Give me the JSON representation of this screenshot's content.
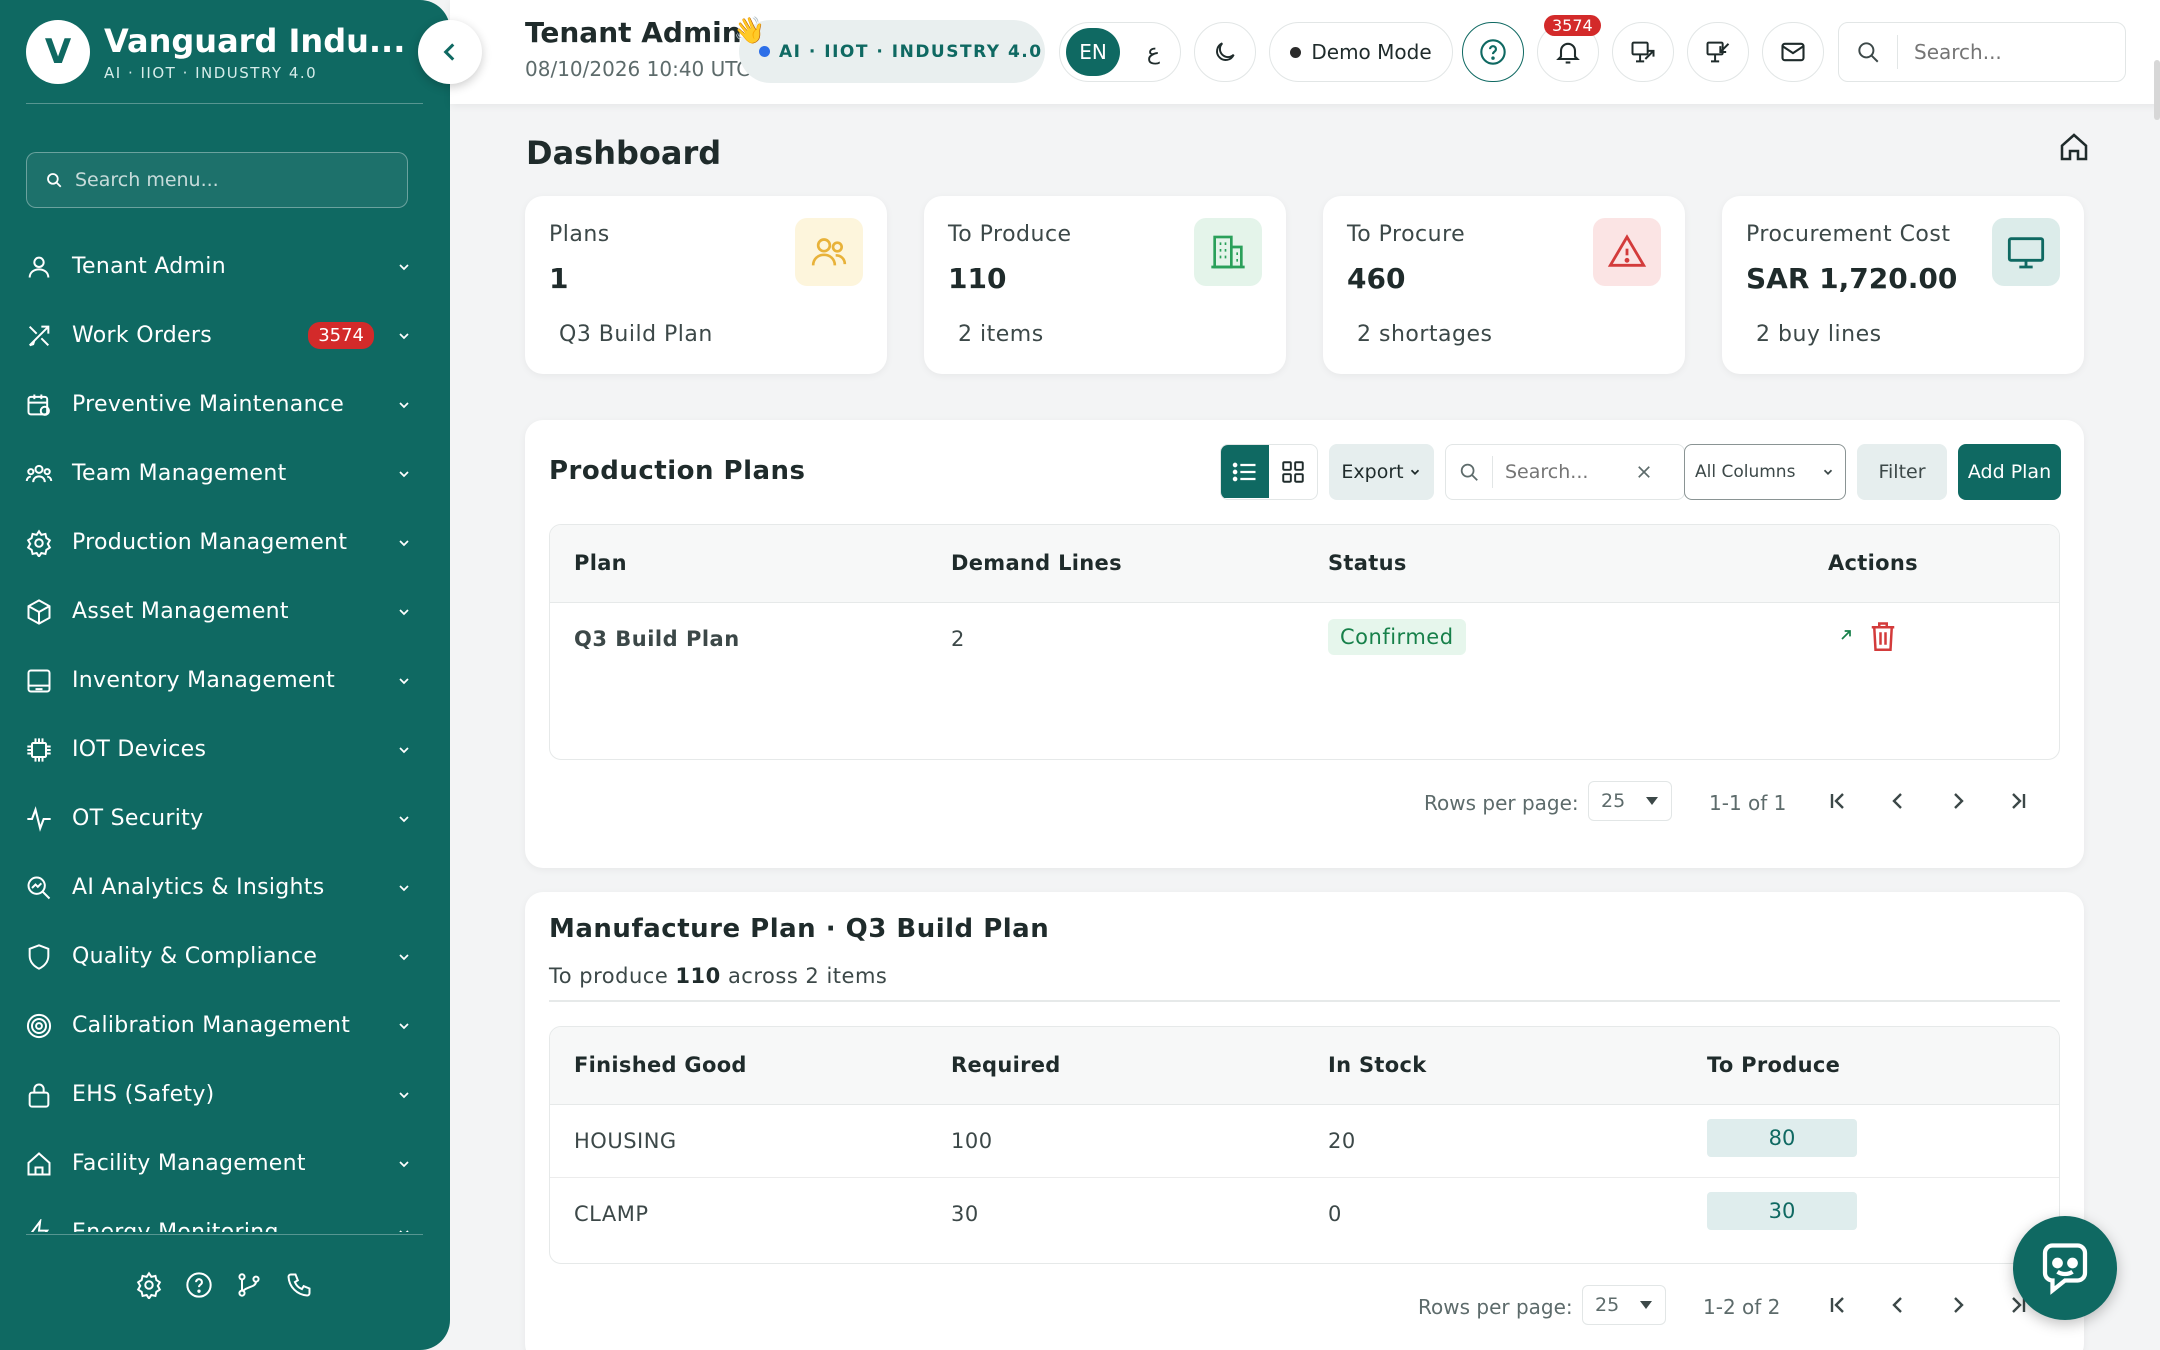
{
  "brand": {
    "initial": "V",
    "name": "Vanguard Indu...",
    "tagline": "AI · IIOT · INDUSTRY 4.0"
  },
  "sidebar": {
    "search_placeholder": "Search menu...",
    "items": [
      {
        "label": "Tenant Admin",
        "icon": "user-icon"
      },
      {
        "label": "Work Orders",
        "icon": "tools-icon",
        "badge": "3574"
      },
      {
        "label": "Preventive Maintenance",
        "icon": "calendar-gear-icon"
      },
      {
        "label": "Team Management",
        "icon": "team-icon"
      },
      {
        "label": "Production Management",
        "icon": "gear-icon"
      },
      {
        "label": "Asset Management",
        "icon": "box-icon"
      },
      {
        "label": "Inventory Management",
        "icon": "inventory-icon"
      },
      {
        "label": "IOT Devices",
        "icon": "chip-icon"
      },
      {
        "label": "OT Security",
        "icon": "pulse-icon"
      },
      {
        "label": "AI Analytics & Insights",
        "icon": "analytics-icon"
      },
      {
        "label": "Quality & Compliance",
        "icon": "shield-icon"
      },
      {
        "label": "Calibration Management",
        "icon": "target-icon"
      },
      {
        "label": "EHS (Safety)",
        "icon": "lock-icon"
      },
      {
        "label": "Facility Management",
        "icon": "home-icon"
      },
      {
        "label": "Energy Monitoring",
        "icon": "bolt-icon"
      }
    ]
  },
  "header": {
    "user_name": "Tenant Admin",
    "datetime": "08/10/2026 10:40 UTC",
    "ai_tag": "AI · IIOT · INDUSTRY 4.0",
    "lang_en": "EN",
    "lang_ar": "ع",
    "demo_mode": "Demo Mode",
    "notifications": "3574",
    "search_placeholder": "Search..."
  },
  "page": {
    "title": "Dashboard"
  },
  "stats": [
    {
      "label": "Plans",
      "value": "1",
      "sub": "Q3 Build Plan",
      "icon": "people-icon",
      "bg": "#fdf5dc",
      "fg": "#e8b23a"
    },
    {
      "label": "To Produce",
      "value": "110",
      "sub": "2 items",
      "icon": "building-icon",
      "bg": "#e4f4ea",
      "fg": "#2aa05a"
    },
    {
      "label": "To Procure",
      "value": "460",
      "sub": "2 shortages",
      "icon": "alert-icon",
      "bg": "#fbe4e4",
      "fg": "#d33b3b"
    },
    {
      "label": "Procurement Cost",
      "value": "SAR 1,720.00",
      "sub": "2 buy lines",
      "icon": "monitor-icon",
      "bg": "#dcecea",
      "fg": "#0f6962"
    }
  ],
  "plans_card": {
    "title": "Production Plans",
    "export": "Export",
    "search_placeholder": "Search...",
    "columns_select": "All Columns",
    "filter": "Filter",
    "add": "Add Plan",
    "headers": [
      "Plan",
      "Demand Lines",
      "Status",
      "Actions"
    ],
    "rows": [
      {
        "plan": "Q3 Build Plan",
        "demand_lines": "2",
        "status": "Confirmed"
      }
    ],
    "rows_per_page_label": "Rows per page:",
    "rows_per_page": "25",
    "range": "1-1 of 1"
  },
  "manufacture_card": {
    "title": "Manufacture Plan · Q3 Build Plan",
    "sub_prefix": "To produce ",
    "sub_value": "110",
    "sub_suffix": " across 2 items",
    "headers": [
      "Finished Good",
      "Required",
      "In Stock",
      "To Produce"
    ],
    "rows": [
      {
        "good": "HOUSING",
        "required": "100",
        "in_stock": "20",
        "to_produce": "80"
      },
      {
        "good": "CLAMP",
        "required": "30",
        "in_stock": "0",
        "to_produce": "30"
      }
    ],
    "rows_per_page_label": "Rows per page:",
    "rows_per_page": "25",
    "range": "1-2 of 2"
  },
  "colors": {
    "primary": "#0f6962",
    "danger": "#d32a2a",
    "success": "#17804a"
  }
}
